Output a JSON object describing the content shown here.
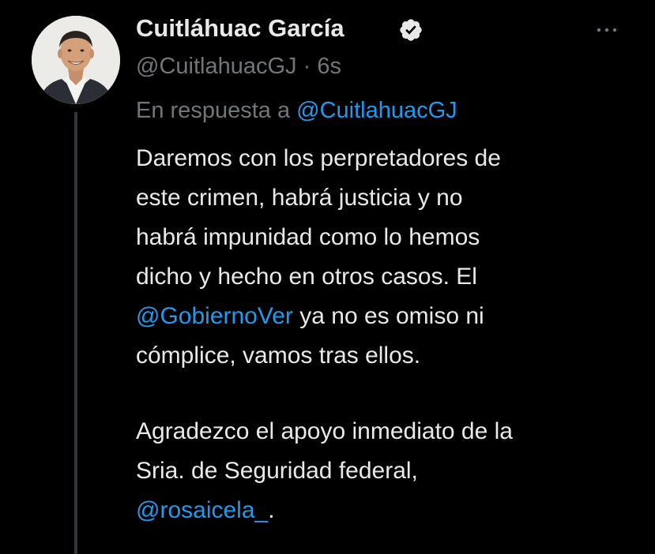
{
  "tweet": {
    "display_name": "Cuitláhuac García",
    "handle": "@CuitlahuacGJ",
    "separator": "·",
    "time": "6s",
    "reply_prefix": "En respuesta a",
    "reply_mention": "@CuitlahuacGJ",
    "paragraph1": {
      "line1": "Daremos con los perpretadores de",
      "line2": "este crimen, habrá justicia y no",
      "line3": "habrá impunidad como lo hemos",
      "line4": "dicho y hecho en otros casos. El",
      "line5_mention": "@GobiernoVer",
      "line5_rest": " ya no es omiso ni",
      "line6": "cómplice, vamos tras ellos."
    },
    "paragraph2": {
      "line1": "Agradezco el apoyo inmediato de la",
      "line2": "Sria. de Seguridad federal,",
      "line3_mention": "@rosaicela_",
      "line3_rest": "."
    }
  },
  "colors": {
    "background": "#000000",
    "text_primary": "#e7e9ea",
    "text_secondary": "#71767b",
    "accent": "#1d9bf0",
    "thread_line": "#333639"
  },
  "icons": {
    "verified": "verified-badge-icon",
    "more": "more-options-icon"
  }
}
